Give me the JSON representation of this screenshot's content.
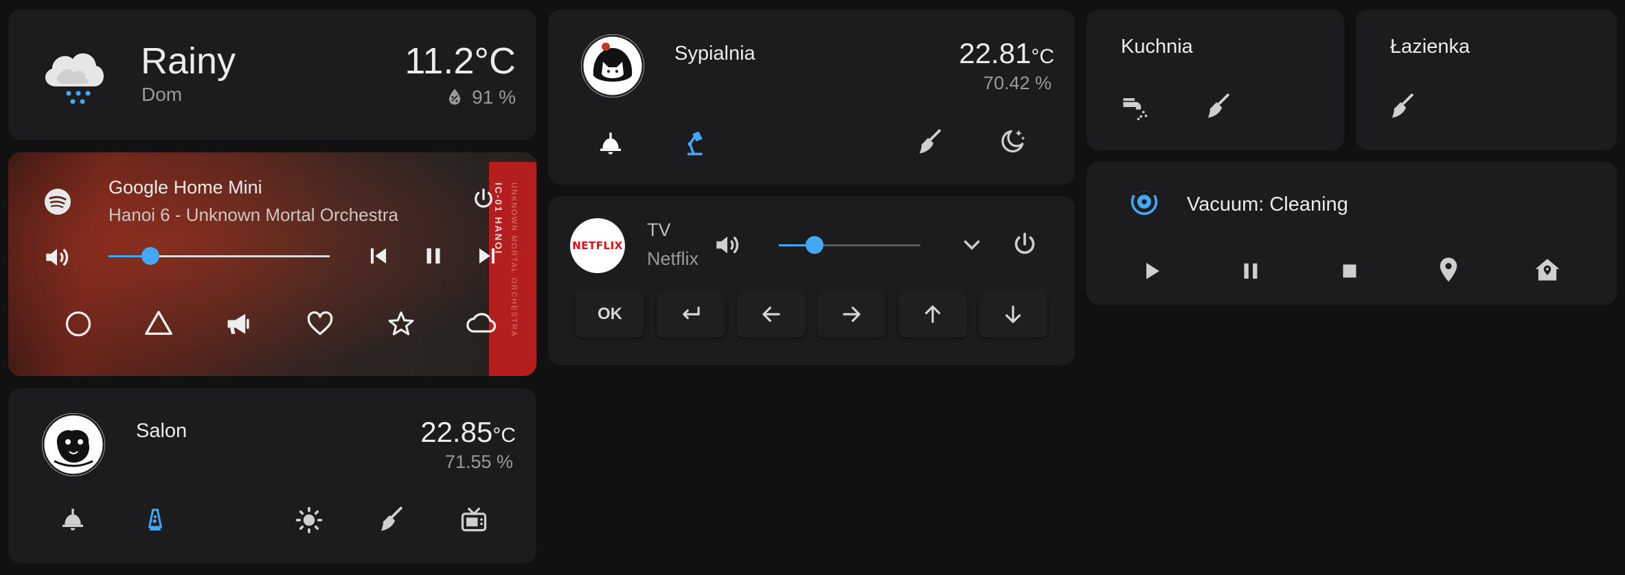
{
  "colors": {
    "accent": "#44a8f4",
    "card": "#1c1c1e",
    "background": "#111111",
    "text": "#e1e1e1",
    "secondary": "#9b9b9b",
    "netflix": "#e50914"
  },
  "weather": {
    "condition": "Rainy",
    "location": "Dom",
    "temperature": "11.2°C",
    "humidity": "91 %",
    "icon": "weather-rainy-icon",
    "humidity_icon": "water-percent-icon"
  },
  "media": {
    "player": "Google Home Mini",
    "now_playing": "Hanoi 6 - Unknown Mortal Orchestra",
    "source_icon": "spotify-icon",
    "volume_level": 0.19,
    "album_text": "IC-01 HANOI",
    "album_text_2": "UNKNOWN MORTAL ORCHESTRA",
    "controls": [
      "power-icon",
      "volume-high-icon",
      "skip-previous-icon",
      "pause-icon",
      "skip-next-icon"
    ],
    "shortcuts": [
      "circle-outline-icon",
      "triangle-outline-icon",
      "bullhorn-icon",
      "heart-outline-icon",
      "star-outline-icon",
      "cloud-outline-icon"
    ]
  },
  "salon": {
    "name": "Salon",
    "temperature": "22.85",
    "temp_unit": "°C",
    "humidity": "71.55 %",
    "buttons": [
      "ceiling-light-icon",
      "lava-lamp-icon",
      "brightness-icon",
      "broom-icon",
      "television-classic-icon"
    ]
  },
  "sypialnia": {
    "name": "Sypialnia",
    "temperature": "22.81",
    "temp_unit": "°C",
    "humidity": "70.42 %",
    "buttons": [
      "ceiling-light-icon",
      "desk-lamp-icon",
      "broom-icon",
      "weather-night-icon"
    ]
  },
  "tv": {
    "name": "TV",
    "source": "Netflix",
    "logo": "NETFLIX",
    "volume_level": 0.25,
    "keys": [
      "OK",
      "keyboard-return-icon",
      "arrow-left-icon",
      "arrow-right-icon",
      "arrow-up-icon",
      "arrow-down-icon"
    ]
  },
  "kuchnia": {
    "name": "Kuchnia",
    "buttons": [
      "faucet-icon",
      "broom-icon"
    ]
  },
  "lazienka": {
    "name": "Łazienka",
    "buttons": [
      "broom-icon"
    ]
  },
  "vacuum": {
    "title": "Vacuum: Cleaning",
    "icon": "robot-vacuum-icon",
    "buttons": [
      "play-icon",
      "pause-icon",
      "stop-icon",
      "map-marker-icon",
      "home-map-marker-icon"
    ]
  }
}
